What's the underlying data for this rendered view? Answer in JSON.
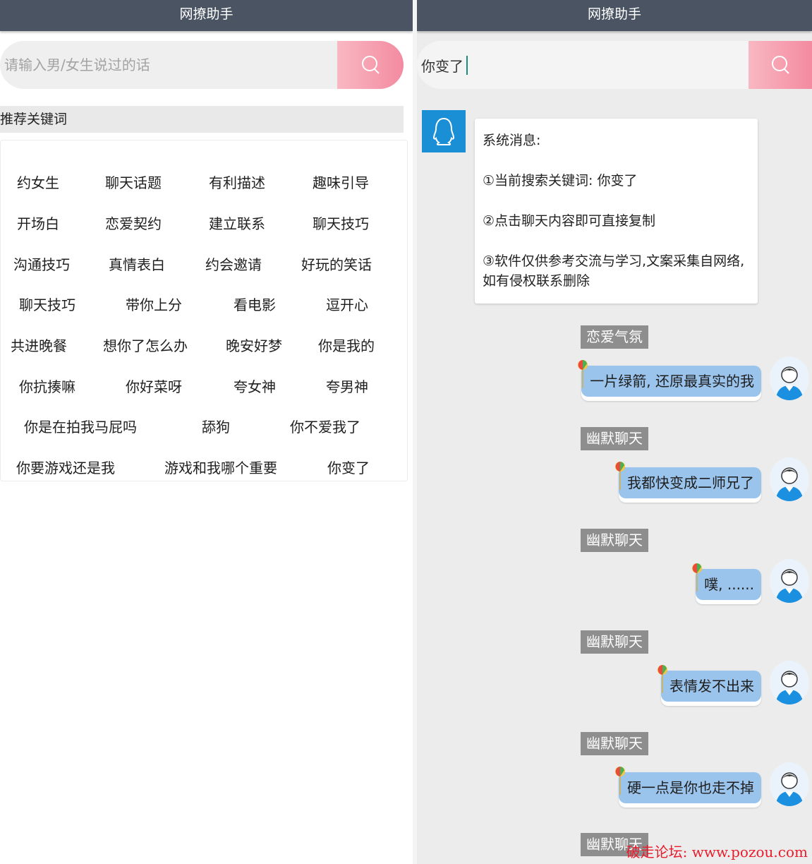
{
  "left": {
    "title": "网撩助手",
    "search": {
      "placeholder": "请输入男/女生说过的话",
      "value": ""
    },
    "keywords_header": "推荐关键词",
    "keywords": [
      "约女生",
      "聊天话题",
      "有利描述",
      "趣味引导",
      "开场白",
      "恋爱契约",
      "建立联系",
      "聊天技巧",
      "沟通技巧",
      "真情表白",
      "约会邀请",
      "好玩的笑话",
      "聊天技巧",
      "带你上分",
      "看电影",
      "逗开心",
      "共进晚餐",
      "想你了怎么办",
      "晚安好梦",
      "你是我的",
      "你抗揍嘛",
      "你好菜呀",
      "夸女神",
      "夸男神",
      "你是在拍我马屁吗",
      "舔狗",
      "你不爱我了",
      "你要游戏还是我",
      "游戏和我哪个重要",
      "你变了"
    ]
  },
  "right": {
    "title": "网撩助手",
    "search": {
      "value": "你变了"
    },
    "system_message": {
      "title": "系统消息:",
      "lines": [
        "①当前搜索关键词: 你变了",
        "②点击聊天内容即可直接复制",
        "③软件仅供参考交流与学习,文案采集自网络,如有侵权联系删除"
      ]
    },
    "messages": [
      {
        "tag": "恋爱气氛",
        "text": "一片绿箭, 还原最真实的我"
      },
      {
        "tag": "幽默聊天",
        "text": "我都快变成二师兄了"
      },
      {
        "tag": "幽默聊天",
        "text": "噗, ......"
      },
      {
        "tag": "幽默聊天",
        "text": "表情发不出来"
      },
      {
        "tag": "幽默聊天",
        "text": "硬一点是你也走不掉"
      },
      {
        "tag": "幽默聊天",
        "text": ""
      }
    ]
  },
  "watermark": "破走论坛: www.pozou.com",
  "colors": {
    "titlebar": "#4a5462",
    "search_button": "#f48aa0",
    "bubble": "#9bc4ec",
    "tag": "#8e8e8e",
    "system_avatar": "#1a8fd6",
    "watermark": "#e81d2c"
  },
  "icons": {
    "search": "search-icon",
    "system_avatar": "penguin-icon",
    "user_avatar": "user-avatar-icon",
    "balloon": "balloon-icon"
  }
}
